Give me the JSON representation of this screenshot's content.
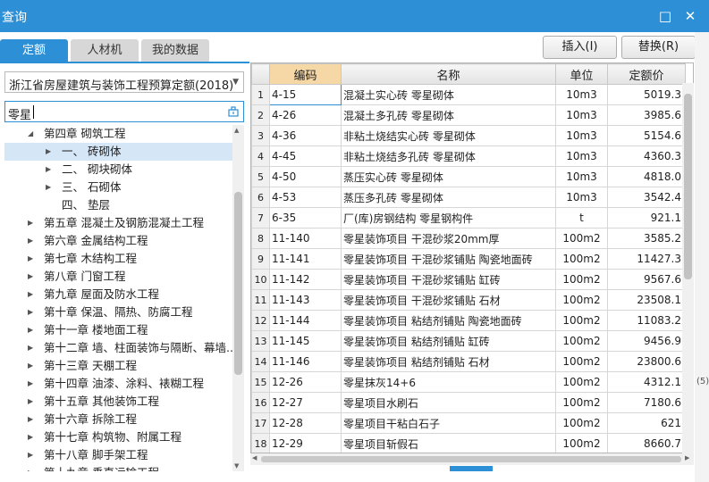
{
  "window": {
    "title": "查询"
  },
  "tabs": [
    {
      "label": "定额",
      "active": true
    },
    {
      "label": "人材机",
      "active": false
    },
    {
      "label": "我的数据",
      "active": false
    }
  ],
  "buttons": {
    "insert": "插入(I)",
    "replace": "替换(R)"
  },
  "library_select": {
    "value": "浙江省房屋建筑与装饰工程预算定额(2018)"
  },
  "search": {
    "value": "零星"
  },
  "tree": [
    {
      "label": "第四章 砌筑工程",
      "expander": "◢",
      "indent": 1,
      "selected": false
    },
    {
      "label": "一、 砖砌体",
      "expander": "▶",
      "indent": 2,
      "selected": true
    },
    {
      "label": "二、 砌块砌体",
      "expander": "▶",
      "indent": 2,
      "selected": false
    },
    {
      "label": "三、 石砌体",
      "expander": "▶",
      "indent": 2,
      "selected": false
    },
    {
      "label": "四、 垫层",
      "expander": "",
      "indent": 2,
      "selected": false
    },
    {
      "label": "第五章 混凝土及钢筋混凝土工程",
      "expander": "▶",
      "indent": 1,
      "selected": false
    },
    {
      "label": "第六章 金属结构工程",
      "expander": "▶",
      "indent": 1,
      "selected": false
    },
    {
      "label": "第七章 木结构工程",
      "expander": "▶",
      "indent": 1,
      "selected": false
    },
    {
      "label": "第八章 门窗工程",
      "expander": "▶",
      "indent": 1,
      "selected": false
    },
    {
      "label": "第九章 屋面及防水工程",
      "expander": "▶",
      "indent": 1,
      "selected": false
    },
    {
      "label": "第十章 保温、隔热、防腐工程",
      "expander": "▶",
      "indent": 1,
      "selected": false
    },
    {
      "label": "第十一章 楼地面工程",
      "expander": "▶",
      "indent": 1,
      "selected": false
    },
    {
      "label": "第十二章 墙、柱面装饰与隔断、幕墙...",
      "expander": "▶",
      "indent": 1,
      "selected": false
    },
    {
      "label": "第十三章 天棚工程",
      "expander": "▶",
      "indent": 1,
      "selected": false
    },
    {
      "label": "第十四章 油漆、涂料、裱糊工程",
      "expander": "▶",
      "indent": 1,
      "selected": false
    },
    {
      "label": "第十五章 其他装饰工程",
      "expander": "▶",
      "indent": 1,
      "selected": false
    },
    {
      "label": "第十六章 拆除工程",
      "expander": "▶",
      "indent": 1,
      "selected": false
    },
    {
      "label": "第十七章 构筑物、附属工程",
      "expander": "▶",
      "indent": 1,
      "selected": false
    },
    {
      "label": "第十八章 脚手架工程",
      "expander": "▶",
      "indent": 1,
      "selected": false
    },
    {
      "label": "第十九章 垂直运输工程",
      "expander": "▶",
      "indent": 1,
      "selected": false
    }
  ],
  "table": {
    "headers": {
      "code": "编码",
      "name": "名称",
      "unit": "单位",
      "price": "定额价"
    },
    "rows": [
      {
        "num": "1",
        "code": "4-15",
        "name": "混凝土实心砖 零星砌体",
        "unit": "10m3",
        "price": "5019.3"
      },
      {
        "num": "2",
        "code": "4-26",
        "name": "混凝土多孔砖 零星砌体",
        "unit": "10m3",
        "price": "3985.6"
      },
      {
        "num": "3",
        "code": "4-36",
        "name": "非粘土烧结实心砖 零星砌体",
        "unit": "10m3",
        "price": "5154.6"
      },
      {
        "num": "4",
        "code": "4-45",
        "name": "非粘土烧结多孔砖 零星砌体",
        "unit": "10m3",
        "price": "4360.3"
      },
      {
        "num": "5",
        "code": "4-50",
        "name": "蒸压实心砖 零星砌体",
        "unit": "10m3",
        "price": "4818.0"
      },
      {
        "num": "6",
        "code": "4-53",
        "name": "蒸压多孔砖 零星砌体",
        "unit": "10m3",
        "price": "3542.4"
      },
      {
        "num": "7",
        "code": "6-35",
        "name": "厂(库)房钢结构 零星钢构件",
        "unit": "t",
        "price": "921.1"
      },
      {
        "num": "8",
        "code": "11-140",
        "name": "零星装饰项目 干混砂浆20mm厚",
        "unit": "100m2",
        "price": "3585.2"
      },
      {
        "num": "9",
        "code": "11-141",
        "name": "零星装饰项目 干混砂浆铺贴 陶瓷地面砖",
        "unit": "100m2",
        "price": "11427.3"
      },
      {
        "num": "10",
        "code": "11-142",
        "name": "零星装饰项目 干混砂浆铺贴 缸砖",
        "unit": "100m2",
        "price": "9567.6"
      },
      {
        "num": "11",
        "code": "11-143",
        "name": "零星装饰项目 干混砂浆铺贴 石材",
        "unit": "100m2",
        "price": "23508.1"
      },
      {
        "num": "12",
        "code": "11-144",
        "name": "零星装饰项目 粘结剂铺贴 陶瓷地面砖",
        "unit": "100m2",
        "price": "11083.2"
      },
      {
        "num": "13",
        "code": "11-145",
        "name": "零星装饰项目 粘结剂铺贴 缸砖",
        "unit": "100m2",
        "price": "9456.9"
      },
      {
        "num": "14",
        "code": "11-146",
        "name": "零星装饰项目 粘结剂铺贴 石材",
        "unit": "100m2",
        "price": "23800.6"
      },
      {
        "num": "15",
        "code": "12-26",
        "name": "零星抹灰14+6",
        "unit": "100m2",
        "price": "4312.1"
      },
      {
        "num": "16",
        "code": "12-27",
        "name": "零星项目水刷石",
        "unit": "100m2",
        "price": "7180.6"
      },
      {
        "num": "17",
        "code": "12-28",
        "name": "零星项目干粘白石子",
        "unit": "100m2",
        "price": "621"
      },
      {
        "num": "18",
        "code": "12-29",
        "name": "零星项目斩假石",
        "unit": "100m2",
        "price": "8660.7"
      }
    ]
  },
  "right_edge_fragments": [
    "",
    "(5)"
  ],
  "colors": {
    "accent": "#2d8fd6",
    "active_header": "#f5d8a5",
    "selected_row": "#d5e6f6"
  }
}
